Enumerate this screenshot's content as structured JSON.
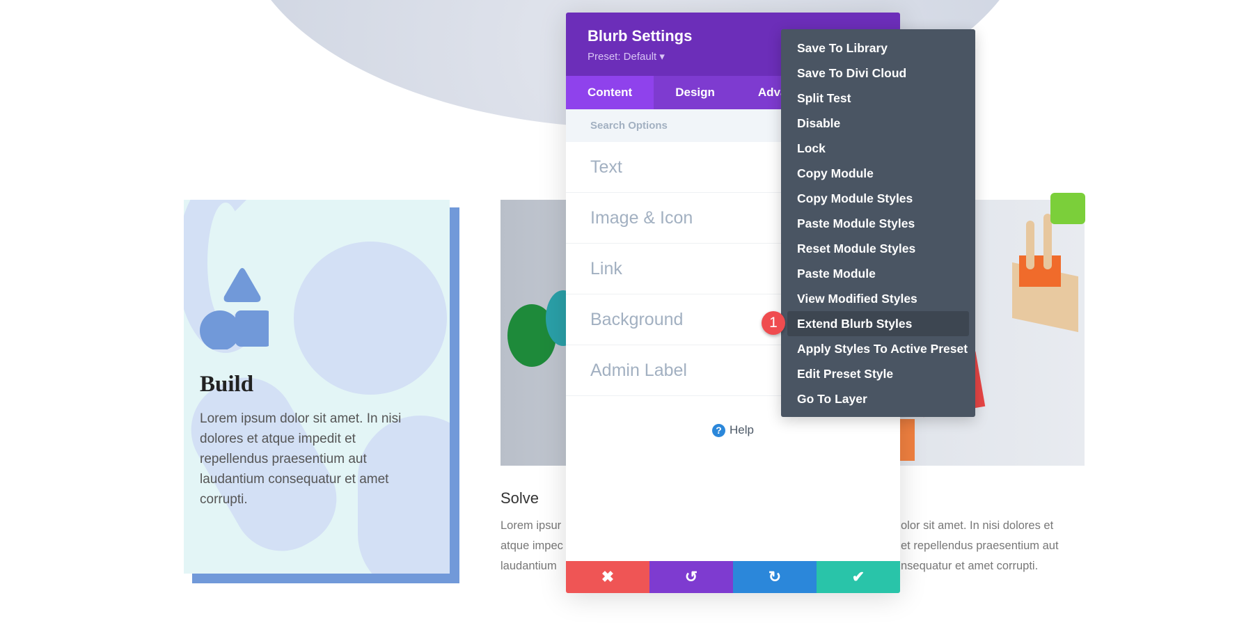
{
  "panel": {
    "title": "Blurb Settings",
    "preset": "Preset: Default ▾",
    "tabs": [
      "Content",
      "Design",
      "Adva"
    ],
    "search_placeholder": "Search Options",
    "sections": [
      "Text",
      "Image & Icon",
      "Link",
      "Background",
      "Admin Label"
    ],
    "help": "Help",
    "buttons": {
      "cancel": "✖",
      "undo": "↺",
      "redo": "↻",
      "save": "✔"
    }
  },
  "menu": {
    "items": [
      "Save To Library",
      "Save To Divi Cloud",
      "Split Test",
      "Disable",
      "Lock",
      "Copy Module",
      "Copy Module Styles",
      "Paste Module Styles",
      "Reset Module Styles",
      "Paste Module",
      "View Modified Styles",
      "Extend Blurb Styles",
      "Apply Styles To Active Preset",
      "Edit Preset Style",
      "Go To Layer"
    ],
    "highlighted": "Extend Blurb Styles"
  },
  "badge": "1",
  "page": {
    "build_title": "Build",
    "build_text": "Lorem ipsum dolor sit amet. In nisi dolores et atque impedit et repellendus praesentium aut laudantium consequatur et amet corrupti.",
    "solve_title": "Solve",
    "solve_lines": [
      "Lorem ipsur",
      "atque impec",
      "laudantium"
    ],
    "right_lines": [
      "olor sit amet. In nisi dolores et",
      "et repellendus praesentium aut",
      "nsequatur et amet corrupti."
    ]
  },
  "colors": {
    "purple": "#6c2eb9",
    "menu": "#4a5563",
    "cancel": "#ef5555",
    "undo": "#7e3bd0",
    "redo": "#2b87da",
    "save": "#29c4a9",
    "accent_blue": "#7199d9"
  }
}
